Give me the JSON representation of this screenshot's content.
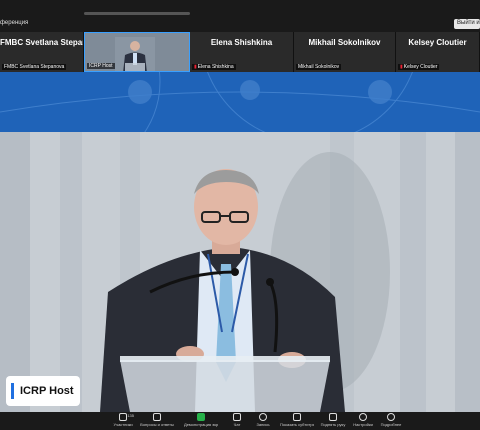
{
  "window": {
    "conference_label": "ференция",
    "leave_button": "Выйти из"
  },
  "gallery": {
    "tiles": [
      {
        "name": "FMBC Svetlana Stepano...",
        "label": "FMBC Svetlana Stepanova",
        "muted": false,
        "video": false
      },
      {
        "name": "",
        "label": "ICRP Host",
        "muted": false,
        "video": true
      },
      {
        "name": "Elena Shishkina",
        "label": "Elena Shishkina",
        "muted": true,
        "video": false
      },
      {
        "name": "Mikhail Sokolnikov",
        "label": "Mikhail Sokolnikov",
        "muted": false,
        "video": false
      },
      {
        "name": "Kelsey Cloutier",
        "label": "Kelsey Cloutier",
        "muted": true,
        "video": false
      }
    ]
  },
  "main": {
    "host_label": "ICRP Host"
  },
  "toolbar": {
    "participants": {
      "label": "Участники",
      "count": "135"
    },
    "qa": {
      "label": "Вопросы и ответы"
    },
    "share": {
      "label": "Демонстрация экра..."
    },
    "chat": {
      "label": "Чат"
    },
    "record": {
      "label": "Запись"
    },
    "captions": {
      "label": "Показать субтитры"
    },
    "raise_hand": {
      "label": "Поднять руку"
    },
    "settings": {
      "label": "Настройки"
    },
    "more": {
      "label": "Подробнее"
    }
  },
  "colors": {
    "banner_blue": "#1f63b8",
    "accent": "#1f6fe0",
    "share_green": "#26b24a"
  }
}
